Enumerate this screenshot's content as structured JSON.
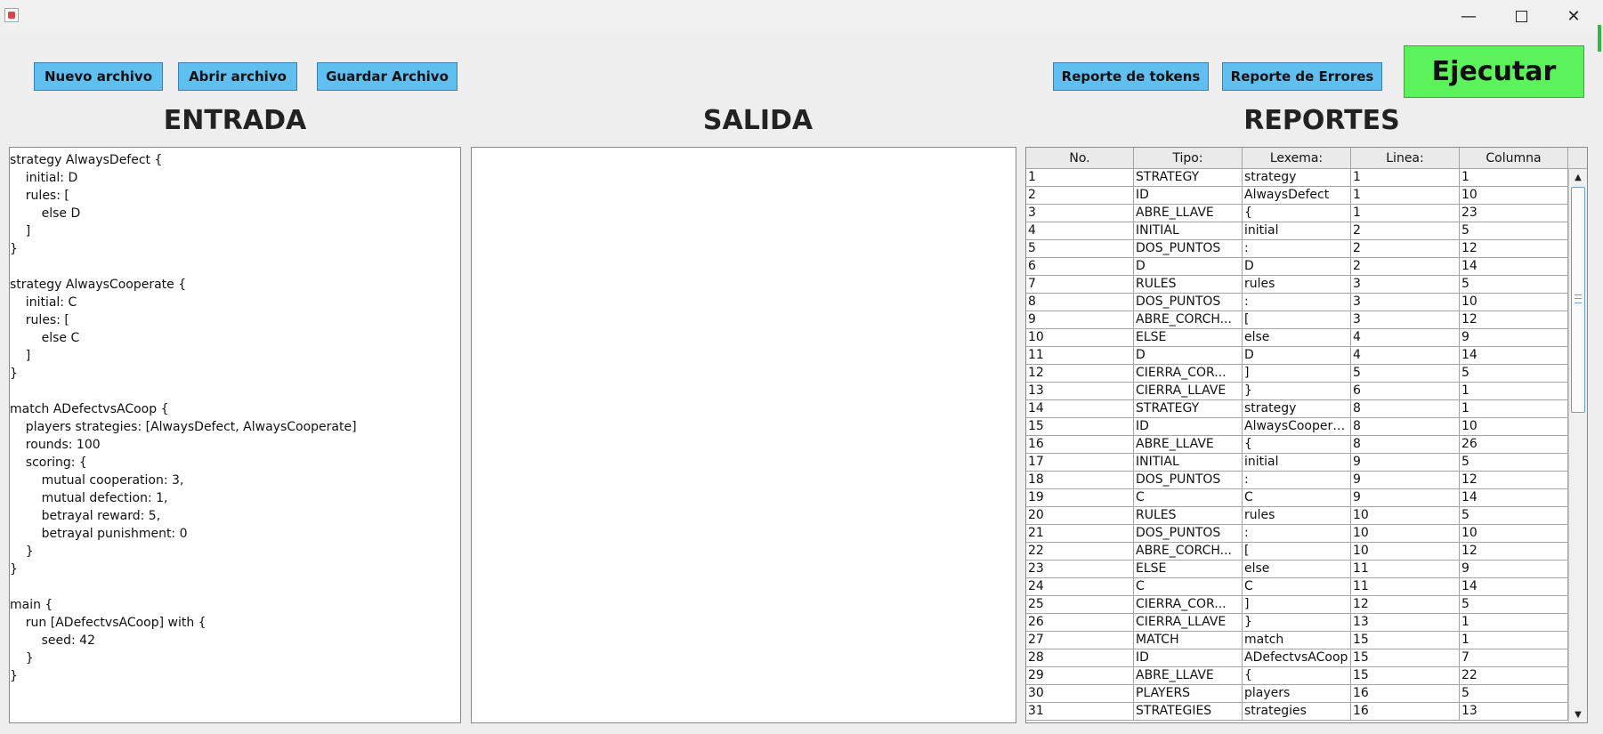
{
  "window": {
    "minimize_glyph": "—",
    "close_glyph": "✕"
  },
  "toolbar": {
    "new_file": "Nuevo archivo",
    "open_file": "Abrir archivo",
    "save_file": "Guardar Archivo",
    "token_report": "Reporte de tokens",
    "error_report": "Reporte de Errores",
    "run": "Ejecutar"
  },
  "colors": {
    "button_blue": "#5ebff0",
    "run_green": "#5cf25c",
    "scroll_thumb_border": "#6b9ed3"
  },
  "panels": {
    "input_title": "ENTRADA",
    "output_title": "SALIDA",
    "reports_title": "REPORTES"
  },
  "editor": {
    "lines": [
      "strategy AlwaysDefect {",
      "    initial: D",
      "    rules: [",
      "        else D",
      "    ]",
      "}",
      "",
      "strategy AlwaysCooperate {",
      "    initial: C",
      "    rules: [",
      "        else C",
      "    ]",
      "}",
      "",
      "match ADefectvsACoop {",
      "    players strategies: [AlwaysDefect, AlwaysCooperate]",
      "    rounds: 100",
      "    scoring: {",
      "        mutual cooperation: 3,",
      "        mutual defection: 1,",
      "        betrayal reward: 5,",
      "        betrayal punishment: 0",
      "    }",
      "}",
      "",
      "main {",
      "    run [ADefectvsACoop] with {",
      "        seed: 42",
      "    }",
      "}"
    ]
  },
  "output": {
    "text": ""
  },
  "token_table": {
    "headers": [
      "No.",
      "Tipo:",
      "Lexema:",
      "Linea:",
      "Columna"
    ],
    "rows": [
      [
        "1",
        "STRATEGY",
        "strategy",
        "1",
        "1"
      ],
      [
        "2",
        "ID",
        "AlwaysDefect",
        "1",
        "10"
      ],
      [
        "3",
        "ABRE_LLAVE",
        "{",
        "1",
        "23"
      ],
      [
        "4",
        "INITIAL",
        "initial",
        "2",
        "5"
      ],
      [
        "5",
        "DOS_PUNTOS",
        ":",
        "2",
        "12"
      ],
      [
        "6",
        "D",
        "D",
        "2",
        "14"
      ],
      [
        "7",
        "RULES",
        "rules",
        "3",
        "5"
      ],
      [
        "8",
        "DOS_PUNTOS",
        ":",
        "3",
        "10"
      ],
      [
        "9",
        "ABRE_CORCH...",
        "[",
        "3",
        "12"
      ],
      [
        "10",
        "ELSE",
        "else",
        "4",
        "9"
      ],
      [
        "11",
        "D",
        "D",
        "4",
        "14"
      ],
      [
        "12",
        "CIERRA_COR...",
        "]",
        "5",
        "5"
      ],
      [
        "13",
        "CIERRA_LLAVE",
        "}",
        "6",
        "1"
      ],
      [
        "14",
        "STRATEGY",
        "strategy",
        "8",
        "1"
      ],
      [
        "15",
        "ID",
        "AlwaysCooperate",
        "8",
        "10"
      ],
      [
        "16",
        "ABRE_LLAVE",
        "{",
        "8",
        "26"
      ],
      [
        "17",
        "INITIAL",
        "initial",
        "9",
        "5"
      ],
      [
        "18",
        "DOS_PUNTOS",
        ":",
        "9",
        "12"
      ],
      [
        "19",
        "C",
        "C",
        "9",
        "14"
      ],
      [
        "20",
        "RULES",
        "rules",
        "10",
        "5"
      ],
      [
        "21",
        "DOS_PUNTOS",
        ":",
        "10",
        "10"
      ],
      [
        "22",
        "ABRE_CORCH...",
        "[",
        "10",
        "12"
      ],
      [
        "23",
        "ELSE",
        "else",
        "11",
        "9"
      ],
      [
        "24",
        "C",
        "C",
        "11",
        "14"
      ],
      [
        "25",
        "CIERRA_COR...",
        "]",
        "12",
        "5"
      ],
      [
        "26",
        "CIERRA_LLAVE",
        "}",
        "13",
        "1"
      ],
      [
        "27",
        "MATCH",
        "match",
        "15",
        "1"
      ],
      [
        "28",
        "ID",
        "ADefectvsACoop",
        "15",
        "7"
      ],
      [
        "29",
        "ABRE_LLAVE",
        "{",
        "15",
        "22"
      ],
      [
        "30",
        "PLAYERS",
        "players",
        "16",
        "5"
      ],
      [
        "31",
        "STRATEGIES",
        "strategies",
        "16",
        "13"
      ]
    ]
  },
  "scrollbar": {
    "up_glyph": "▲",
    "down_glyph": "▼"
  }
}
